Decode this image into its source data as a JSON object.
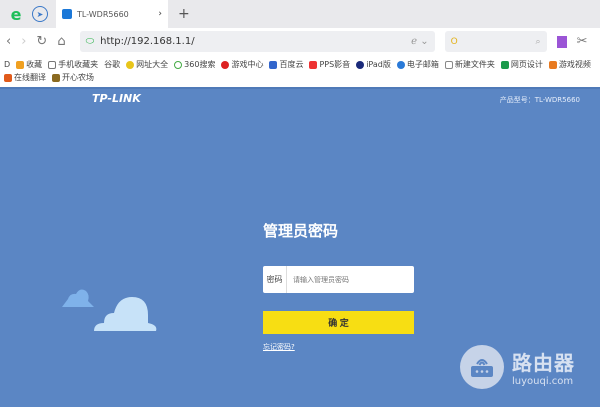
{
  "browser": {
    "tab_title": "TL-WDR5660",
    "url": "http://192.168.1.1/",
    "search_value": "",
    "bookmarks": [
      "收藏",
      "手机收藏夹",
      "谷歌",
      "网址大全",
      "360搜索",
      "游戏中心",
      "百度云",
      "PPS影音",
      "iPad版",
      "电子邮箱",
      "新建文件夹",
      "网页设计",
      "游戏视频",
      "在线翻译",
      "开心农场"
    ]
  },
  "page": {
    "logo": "TP-LINK",
    "model": "产品型号：TL-WDR5660",
    "login_title": "管理员密码",
    "password_label": "密码",
    "password_placeholder": "请输入管理员密码",
    "confirm": "确 定",
    "forgot": "忘记密码?"
  },
  "watermark": {
    "cn": "路由器",
    "en": "luyouqi.com"
  },
  "colors": {
    "background": "#5b86c4",
    "button": "#f7de13"
  }
}
